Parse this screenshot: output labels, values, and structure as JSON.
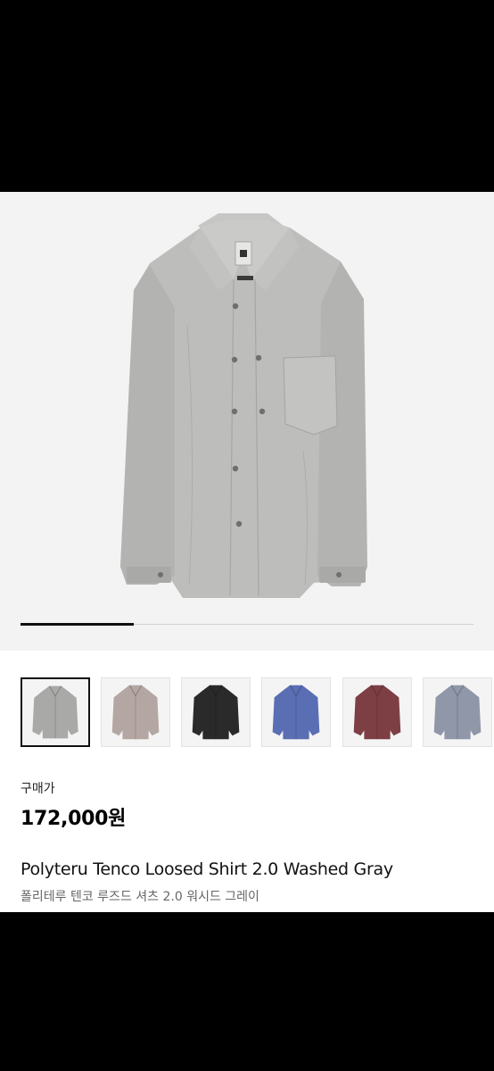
{
  "product": {
    "price_label": "구매가",
    "price": "172,000원",
    "title_en": "Polyteru Tenco Loosed Shirt 2.0 Washed Gray",
    "title_ko": "폴리테루 텐코 루즈드 셔츠 2.0 워시드 그레이"
  },
  "gallery": {
    "progress": 0.25,
    "selected_index": 0,
    "thumbnails": [
      {
        "color": "#a9a9a7",
        "label": "washed-gray"
      },
      {
        "color": "#b4a7a3",
        "label": "pinkish-gray"
      },
      {
        "color": "#2a2a2a",
        "label": "black"
      },
      {
        "color": "#5a6eb4",
        "label": "blue"
      },
      {
        "color": "#7d3f44",
        "label": "burgundy"
      },
      {
        "color": "#8f97a8",
        "label": "blue-gray"
      }
    ]
  },
  "colors": {
    "hero_bg": "#f3f3f3",
    "shirt_main": "#b9b9b7"
  }
}
